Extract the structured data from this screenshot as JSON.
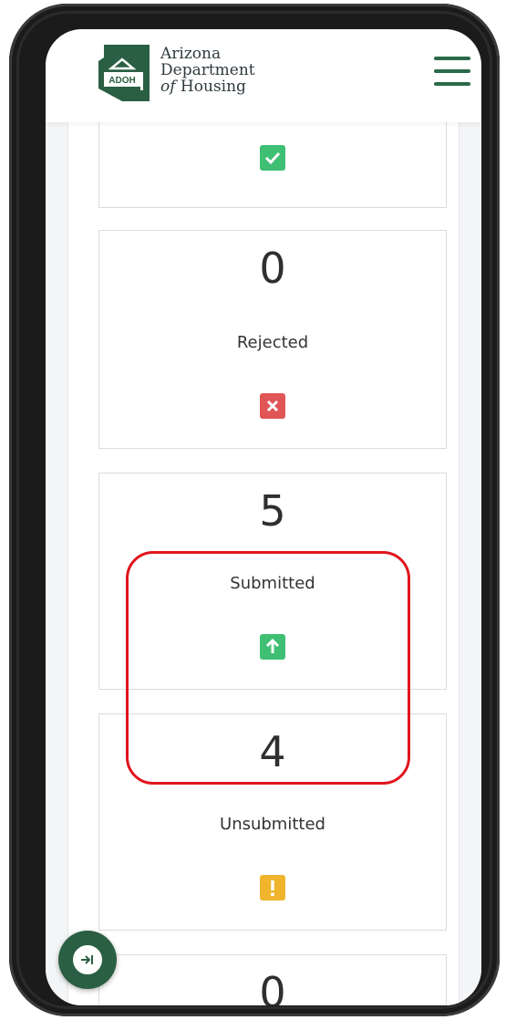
{
  "header": {
    "logo_badge": "ADOH",
    "org_line1": "Arizona",
    "org_line2": "Department",
    "org_line3_em": "of",
    "org_line3_rest": " Housing"
  },
  "cards": [
    {
      "value": "",
      "label": "",
      "status": "approved",
      "icon": "check-icon"
    },
    {
      "value": "0",
      "label": "Rejected",
      "status": "rejected",
      "icon": "x-icon"
    },
    {
      "value": "5",
      "label": "Submitted",
      "status": "submitted",
      "icon": "arrow-up-icon"
    },
    {
      "value": "4",
      "label": "Unsubmitted",
      "status": "unsubmitted",
      "icon": "exclamation-icon"
    },
    {
      "value": "0",
      "label": "",
      "status": "partial",
      "icon": ""
    }
  ],
  "colors": {
    "brand_green": "#2b6a48",
    "check_green": "#3fbf74",
    "reject_red": "#e05656",
    "submit_green": "#3fbf74",
    "warn_yellow": "#f0b52d",
    "highlight_red": "#e0141e"
  }
}
